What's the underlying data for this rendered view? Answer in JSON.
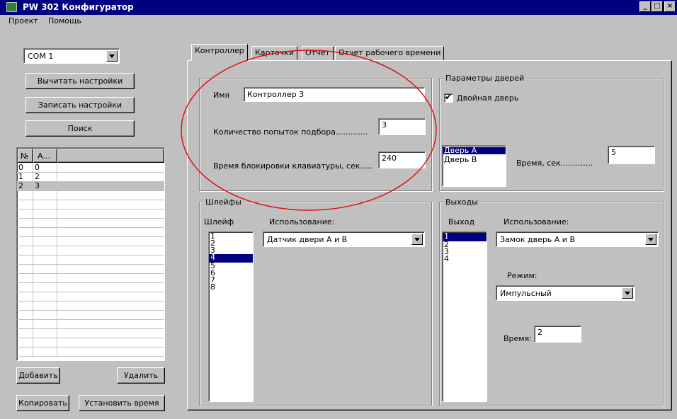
{
  "window": {
    "title": "PW 302 Конфигуратор"
  },
  "menu": [
    "Проект",
    "Помощь"
  ],
  "left": {
    "port_value": "COM 1",
    "buttons": {
      "read": "Вычитать настройки",
      "write": "Записать настройки",
      "search": "Поиск"
    },
    "grid": {
      "headers": [
        "№",
        "А..."
      ],
      "rows": [
        [
          "0",
          "0"
        ],
        [
          "1",
          "2"
        ],
        [
          "2",
          "3"
        ]
      ],
      "selected_row": 2
    },
    "bottom_buttons": {
      "add": "Добавить",
      "delete": "Удалить",
      "copy": "Копировать",
      "settime": "Установить время"
    }
  },
  "tabs": [
    "Контроллер",
    "Карточки",
    "Отчет",
    "Отчет рабочего времени"
  ],
  "controller": {
    "name_label": "Имя",
    "name_value": "Контроллер 3",
    "attempts_label": "Количество попыток подбора.............",
    "attempts_value": "3",
    "lock_label": "Время блокировки клавиатуры, сек.....",
    "lock_value": "240"
  },
  "doors": {
    "title": "Параметры дверей",
    "double_label": "Двойная дверь",
    "double_checked": true,
    "list": [
      "Дверь А",
      "Дверь В"
    ],
    "selected": 0,
    "time_label": "Время, сек.............",
    "time_value": "5"
  },
  "loops": {
    "title": "Шлейфы",
    "col_label": "Шлейф",
    "usage_label": "Использование:",
    "list": [
      "1",
      "2",
      "3",
      "4",
      "5",
      "6",
      "7",
      "8"
    ],
    "selected": 3,
    "usage_value": "Датчик двери А и В"
  },
  "outputs": {
    "title": "Выходы",
    "col_label": "Выход",
    "usage_label": "Использование:",
    "list": [
      "1",
      "2",
      "3",
      "4"
    ],
    "selected": 0,
    "usage_value": "Замок дверь А и В",
    "mode_label": "Режим:",
    "mode_value": "Импульсный",
    "time_label": "Время:",
    "time_value": "2"
  },
  "colors": {
    "titlebar": "#000080",
    "annotation": "#e01010"
  }
}
